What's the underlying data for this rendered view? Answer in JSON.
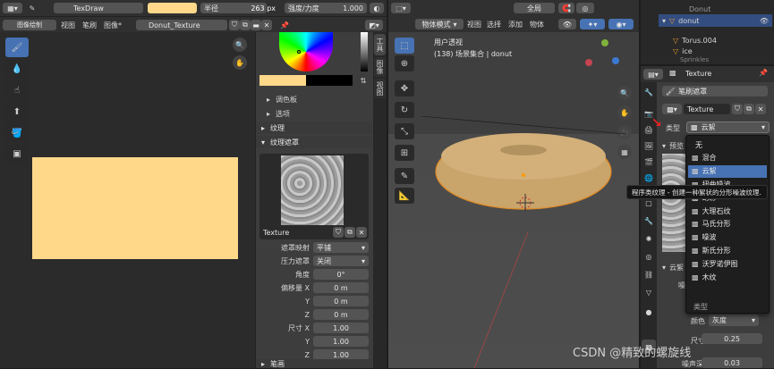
{
  "image_editor": {
    "mode_label": "TexDraw",
    "radius_label": "半径",
    "radius_value": "263 px",
    "strength_label": "强度/力度",
    "strength_value": "1.000",
    "mode_menu": "图像绘制",
    "menu_view": "视图",
    "menu_brush": "笔刷",
    "menu_image": "图像*",
    "image_name": "Donut_Texture",
    "canvas_color": "#ffd88a"
  },
  "brush_panel": {
    "swatch_color": "#ffd88a",
    "palette_label": "调色板",
    "options_label": "选项",
    "texture_label": "纹理",
    "texture_mask_label": "纹理遮罩",
    "texture_name": "Texture",
    "mask_mapping_label": "遮罩映射",
    "mask_mapping_value": "平铺",
    "pressure_mask_label": "压力遮罩",
    "pressure_mask_value": "关闭",
    "angle_label": "角度",
    "angle_value": "0°",
    "offset_label": "偏移量 X",
    "offset_y_label": "Y",
    "offset_z_label": "Z",
    "offset_x_value": "0 m",
    "offset_y_value": "0 m",
    "offset_z_value": "0 m",
    "size_label": "尺寸 X",
    "size_y_label": "Y",
    "size_z_label": "Z",
    "size_x_value": "1.00",
    "size_y_value": "1.00",
    "size_z_value": "1.00",
    "stroke_label": "笔画",
    "tab_tool": "工具",
    "tab_image": "图像",
    "tab_view": "视图"
  },
  "viewport": {
    "mode": "物体模式",
    "menu_view": "视图",
    "menu_select": "选择",
    "menu_add": "添加",
    "menu_object": "物体",
    "transform": "全局",
    "camera_label": "用户透视",
    "collection_label": "(138) 场景集合 | donut"
  },
  "outliner": {
    "items": [
      "donut",
      "Torus.004",
      "ice",
      "Sprinkles"
    ],
    "top_item": "Donut"
  },
  "properties": {
    "header_title": "Texture",
    "brush_mask_label": "笔刷遮罩",
    "texture_name": "Texture",
    "type_label": "类型",
    "type_value": "云絮",
    "preview_label": "预览",
    "clouds_label": "云絮",
    "color_label": "颜色",
    "color_value": "灰度",
    "size_label": "尺寸",
    "size_value": "0.25",
    "depth_label": "噪声深",
    "depth_value": "0.03",
    "noise_label": "噪"
  },
  "type_dropdown": {
    "options": [
      "无",
      "混合",
      "云絮",
      "扭曲噪波",
      "幻彩",
      "大理石纹",
      "马氏分形",
      "噪波",
      "斯氏分形",
      "沃罗诺伊图",
      "木纹"
    ],
    "selected": "云絮",
    "footer": "类型"
  },
  "tooltip": {
    "text": "程序类纹理 - 创建一种絮状的分形噪波纹理."
  },
  "watermark": "CSDN @精致的螺旋线"
}
